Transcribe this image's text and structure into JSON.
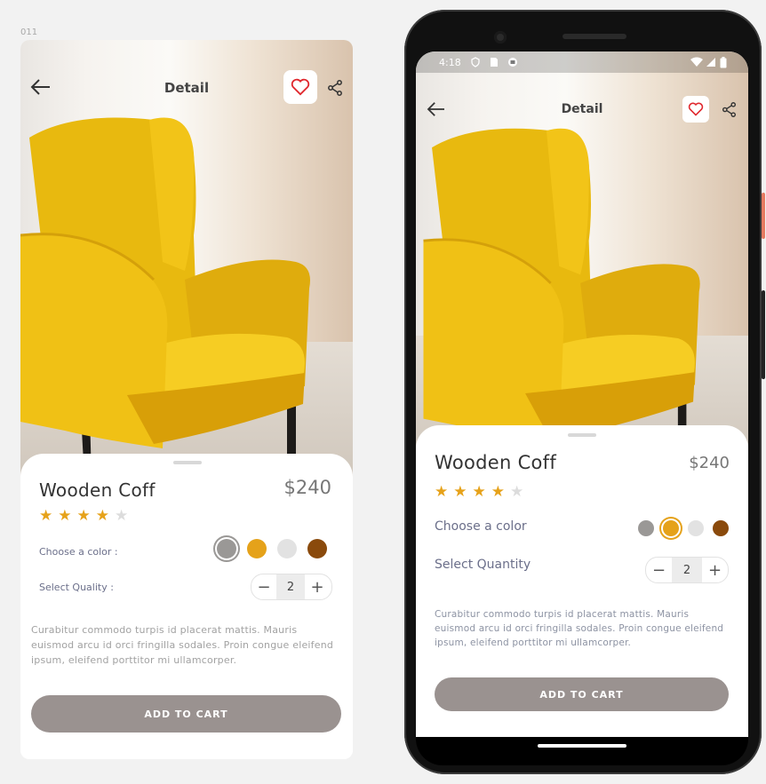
{
  "frame_label": "011",
  "left": {
    "header": {
      "title": "Detail"
    },
    "product": {
      "name": "Wooden Coff",
      "price": "$240",
      "rating": 4,
      "rating_max": 5
    },
    "color_label": "Choose a color :",
    "colors": [
      "#9a9896",
      "#e5a21a",
      "#e2e2e2",
      "#8a4a0c"
    ],
    "selected_color": 0,
    "quantity_label": "Select Quality :",
    "quantity": "2",
    "description": "Curabitur commodo turpis id placerat mattis. Mauris euismod arcu id orci fringilla sodales. Proin congue eleifend ipsum, eleifend porttitor mi ullamcorper.",
    "cart_label": "ADD TO CART"
  },
  "phone": {
    "status": {
      "time": "4:18"
    },
    "header": {
      "title": "Detail"
    },
    "product": {
      "name": "Wooden Coff",
      "price": "$240",
      "rating": 4,
      "rating_max": 5
    },
    "color_label": "Choose a color",
    "colors": [
      "#9a9896",
      "#e5a21a",
      "#e2e2e2",
      "#8a4a0c"
    ],
    "selected_color": 1,
    "quantity_label": "Select Quantity",
    "quantity": "2",
    "description": "Curabitur commodo turpis id placerat mattis. Mauris euismod arcu id orci fringilla sodales. Proin congue eleifend ipsum, eleifend porttitor mi ullamcorper.",
    "cart_label": "ADD TO CART"
  },
  "theme": {
    "accent": "#e5a21a",
    "heart": "#e0282e",
    "button_bg": "#9a9290"
  }
}
